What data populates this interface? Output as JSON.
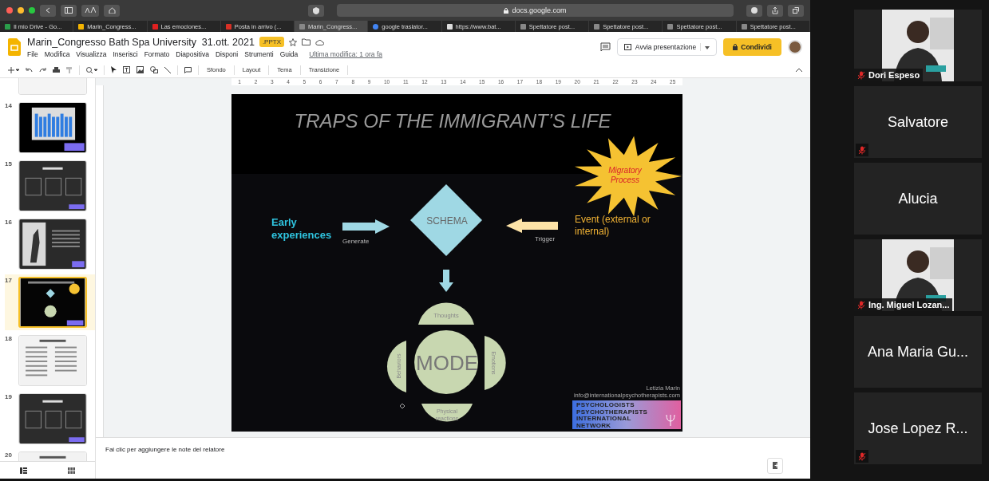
{
  "browser": {
    "address": "docs.google.com",
    "tabs": [
      {
        "label": "Il mio Drive - Go...",
        "kind": "drive",
        "selected": false
      },
      {
        "label": "Marin_Congress...",
        "kind": "slides",
        "selected": false
      },
      {
        "label": "Las emociones...",
        "kind": "youtube",
        "selected": false
      },
      {
        "label": "Posta in arrivo (...",
        "kind": "gmail",
        "selected": false
      },
      {
        "label": "Marin_Congress...",
        "kind": "grey",
        "selected": true
      },
      {
        "label": "google traslator...",
        "kind": "google",
        "selected": false
      },
      {
        "label": "https://www.bat...",
        "kind": "serif",
        "selected": false
      },
      {
        "label": "Spettatore post...",
        "kind": "grey",
        "selected": false
      },
      {
        "label": "Spettatore post...",
        "kind": "grey",
        "selected": false
      },
      {
        "label": "Spettatore post...",
        "kind": "grey",
        "selected": false
      },
      {
        "label": "Spettatore post...",
        "kind": "grey",
        "selected": false
      }
    ]
  },
  "docs": {
    "title": "Marin_Congresso Bath Spa University  31.ott. 2021",
    "badge": ".PPTX",
    "menus": [
      "File",
      "Modifica",
      "Visualizza",
      "Inserisci",
      "Formato",
      "Diapositiva",
      "Disponi",
      "Strumenti",
      "Guida"
    ],
    "last_edit": "Ultima modifica: 1 ora fa",
    "present_button": "Avvia presentazione",
    "share_button": "Condividi",
    "toolbar": [
      "Sfondo",
      "Layout",
      "Tema",
      "Transizione"
    ],
    "ruler": [
      "1",
      "2",
      "3",
      "4",
      "5",
      "6",
      "7",
      "8",
      "9",
      "10",
      "11",
      "12",
      "13",
      "14",
      "15",
      "16",
      "17",
      "18",
      "19",
      "20",
      "21",
      "22",
      "23",
      "24",
      "25"
    ]
  },
  "filmstrip": [
    {
      "kind": "table",
      "selected": false
    },
    {
      "number": "14",
      "kind": "chart",
      "selected": false
    },
    {
      "number": "15",
      "kind": "dark",
      "selected": false
    },
    {
      "number": "16",
      "selected": false
    },
    {
      "number": "17",
      "kind": "diagram",
      "selected": true
    },
    {
      "number": "18",
      "kind": "light",
      "selected": false
    },
    {
      "number": "19",
      "kind": "dark",
      "selected": false
    },
    {
      "number": "20",
      "kind": "light",
      "selected": false
    }
  ],
  "slide": {
    "title": "TRAPS OF THE IMMIGRANT’S LIFE",
    "burst": [
      "Migratory",
      "Process"
    ],
    "input": [
      "Early",
      "experiences"
    ],
    "input_verb": "Generate",
    "center": "SCHEMA",
    "event": [
      "Event (external or",
      "internal)"
    ],
    "event_verb": "Trigger",
    "mode": "MODE",
    "facets": [
      {
        "kind": "top",
        "lines": [
          "Thoughts"
        ]
      },
      {
        "kind": "right",
        "lines": [
          "Emotions"
        ]
      },
      {
        "kind": "bottom",
        "lines": [
          "Physical",
          "reactions"
        ]
      },
      {
        "kind": "left",
        "lines": [
          "Behaviors"
        ]
      }
    ],
    "credit": [
      "Letizia Marin",
      "info@internationalpsychotherapists.com"
    ],
    "logo": [
      "PSYCHOLOGISTS",
      "PSYCHOTHERAPISTS",
      "INTERNATIONAL",
      "NETWORK"
    ]
  },
  "notes": {
    "placeholder": "Fai clic per aggiungere le note del relatore"
  },
  "participants": [
    {
      "name": "Dori Espeso",
      "kind": "video",
      "muted": true
    },
    {
      "name": "Salvatore",
      "kind": "name",
      "muted": true
    },
    {
      "name": "Alucia",
      "kind": "name",
      "muted": false
    },
    {
      "name": "Ing. Miguel Lozan...",
      "kind": "video",
      "muted": true
    },
    {
      "name": "Ana Maria Gu...",
      "kind": "name",
      "muted": false
    },
    {
      "name": "Jose Lopez R...",
      "kind": "name",
      "muted": true
    }
  ]
}
